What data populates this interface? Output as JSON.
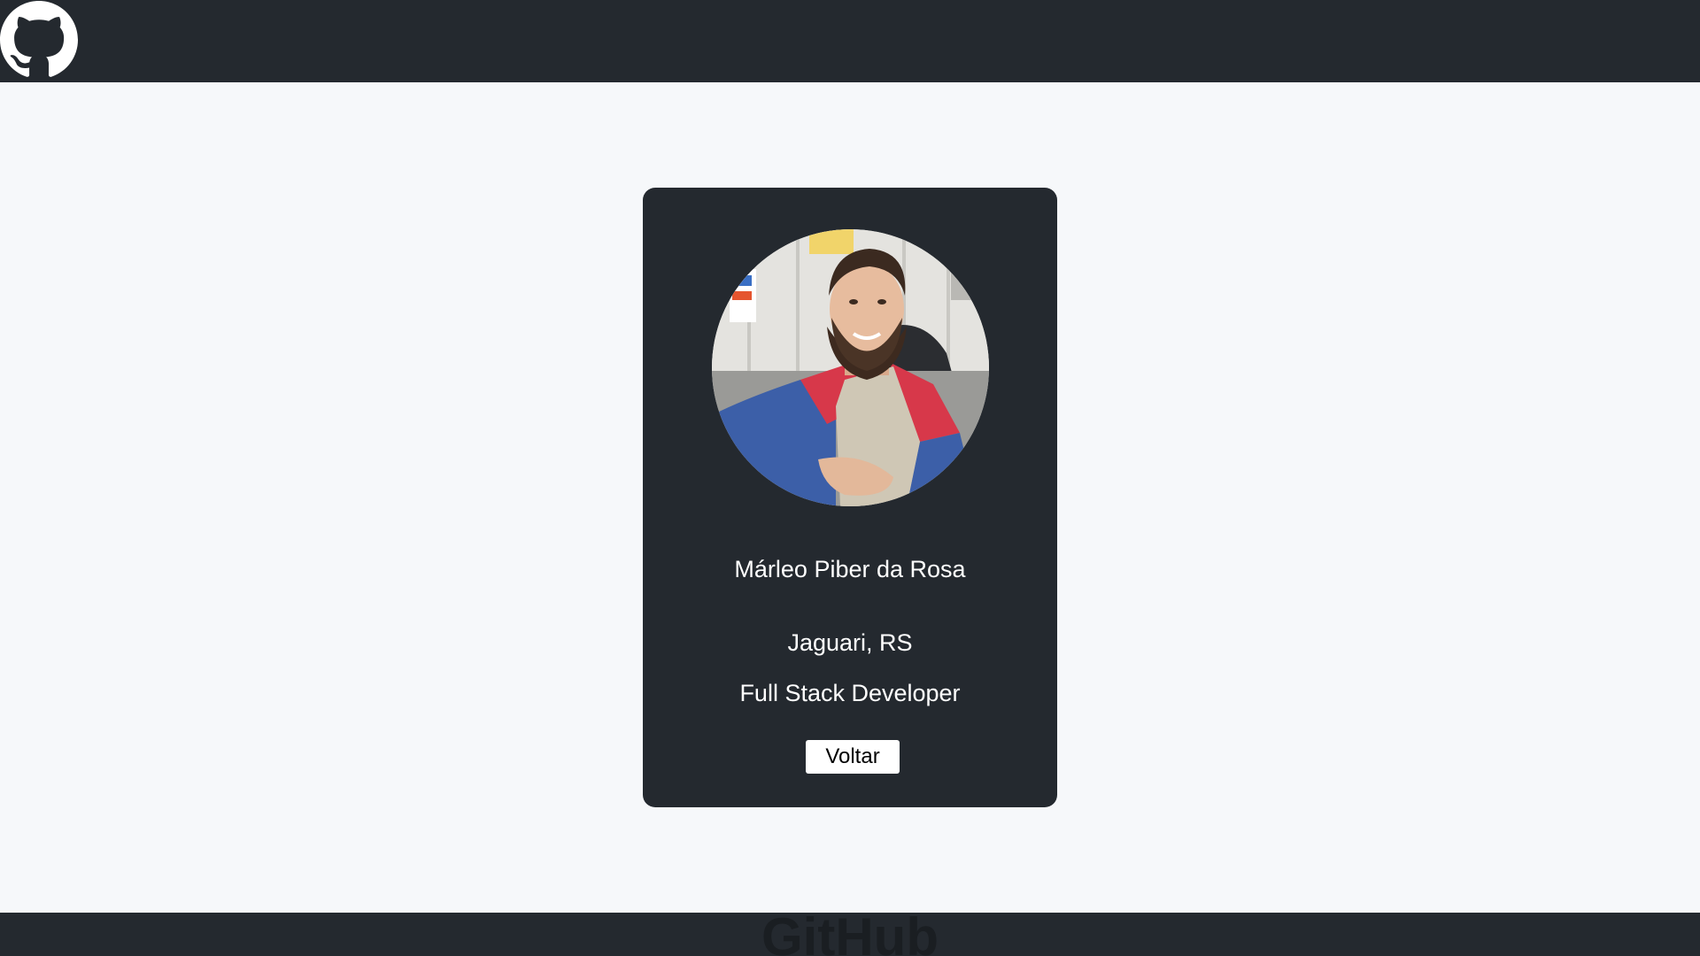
{
  "header": {
    "logo_icon": "github-octocat-icon"
  },
  "profile": {
    "name": "Márleo Piber da Rosa",
    "location": "Jaguari, RS",
    "role": "Full Stack Developer",
    "back_label": "Voltar",
    "avatar_icon": "profile-photo"
  },
  "footer": {
    "brand": "GitHub"
  },
  "colors": {
    "dark": "#24292f",
    "background": "#f6f8fa",
    "button": "#ffffff"
  }
}
